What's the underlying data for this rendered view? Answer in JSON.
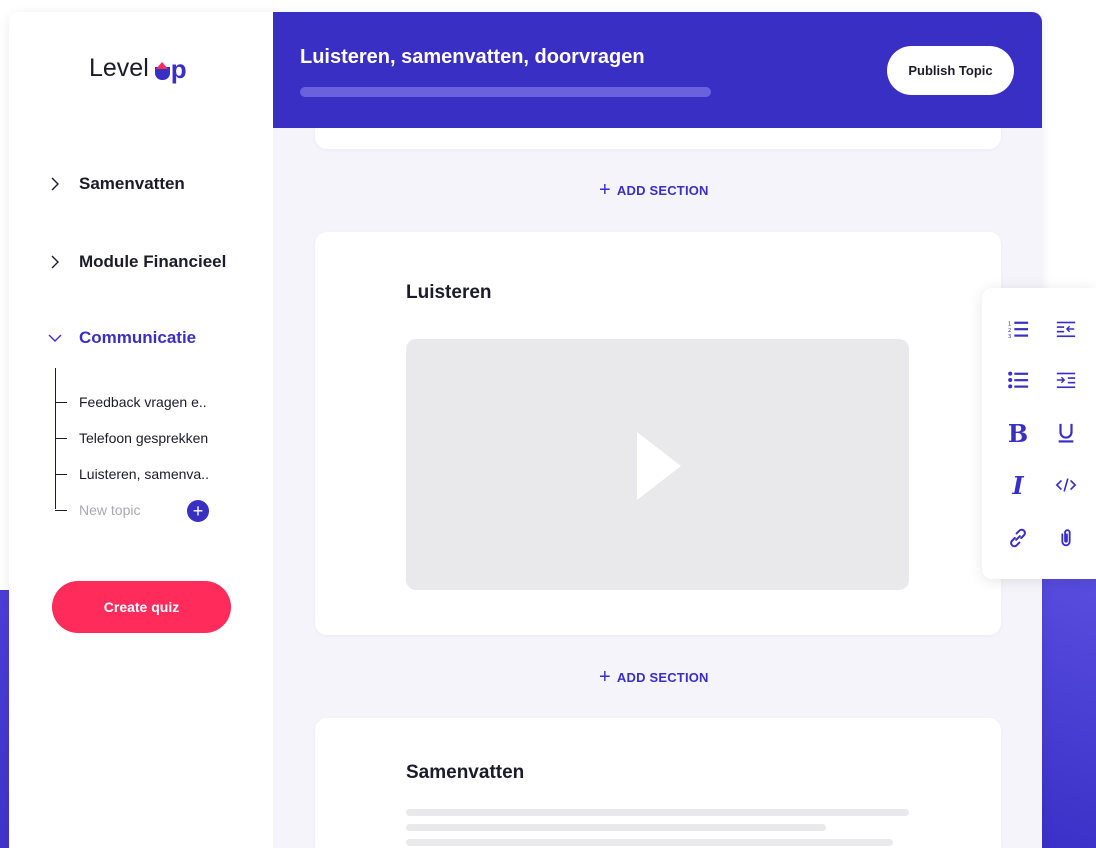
{
  "brand": {
    "name": "Level",
    "name_suffix": "p"
  },
  "sidebar": {
    "groups": [
      {
        "label": "Samenvatten"
      },
      {
        "label": "Module Financieel"
      },
      {
        "label": "Communicatie"
      }
    ],
    "topics": [
      {
        "label": "Feedback vragen e.."
      },
      {
        "label": "Telefoon gesprekken"
      },
      {
        "label": "Luisteren, samenva.."
      }
    ],
    "new_topic_placeholder": "New topic",
    "create_quiz_label": "Create quiz"
  },
  "header": {
    "title": "Luisteren, samenvatten, doorvragen",
    "publish_label": "Publish Topic"
  },
  "content": {
    "add_section_label": "ADD SECTION",
    "sections": [
      {
        "title": "Luisteren"
      },
      {
        "title": "Samenvatten"
      }
    ]
  },
  "colors": {
    "accent": "#3a2fc4",
    "brand_red": "#ff2b5a",
    "text": "#1b1b2a"
  },
  "toolbar": {
    "tools": [
      "ordered-list-icon",
      "outdent-icon",
      "bullet-list-icon",
      "indent-icon",
      "bold-icon",
      "underline-icon",
      "italic-icon",
      "code-icon",
      "link-icon",
      "attachment-icon"
    ]
  }
}
